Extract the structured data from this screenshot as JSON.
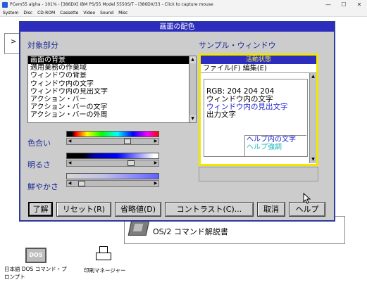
{
  "host": {
    "title": "PCem55 alpha - 101% - [386DX] IBM PS/55 Model 5550S/T - i386DX/33 - Click to capture mouse",
    "menu": [
      "System",
      "Disc",
      "CD-ROM",
      "Cassette",
      "Video",
      "Sound",
      "Misc"
    ],
    "controls": [
      "—",
      "☐",
      "✕"
    ]
  },
  "dialog": {
    "title": "画面の配色",
    "object_label": "対象部分",
    "list_items": [
      "画面の背景",
      "適用業務の作業域",
      "ウィンドウの背景",
      "ウィンドウ内の文字",
      "ウィンドウ内の見出文字",
      "アクション・バー",
      "アクション・バーの文字",
      "アクション・バーの外周"
    ],
    "selected_index": 0,
    "sliders": [
      {
        "label": "色合い",
        "value": 0.7
      },
      {
        "label": "明るさ",
        "value": 0.75
      },
      {
        "label": "鮮やかさ",
        "value": 0.08
      }
    ],
    "sample": {
      "label": "サンプル・ウィンドウ",
      "title": "活動状態",
      "menu": "ファイル(F)  編集(E)",
      "rgb": "RGB: 204 204 204",
      "window_text": "ウィンドウ内の文字",
      "window_heading": "ウィンドウ内の見出文字",
      "output_text": "出力文字",
      "help_text": "ヘルプ内の文字",
      "help_emphasis": "ヘルプ強調"
    },
    "buttons": {
      "ok": "了解",
      "reset": "リセット(R)",
      "default": "省略値(D)",
      "contrast": "コントラスト(C)...",
      "cancel": "取消",
      "help": "ヘルプ"
    }
  },
  "desktop": {
    "bg_window_text": ">",
    "book_label": "OS/2 コマンド解説書",
    "dos_icon_text": "DOS",
    "dos_label": "日本語 DOS コマンド・プロンプト",
    "printer_label": "印刷マネージャー"
  },
  "colors": {
    "dialog_title_bg": "#2c2cbe",
    "label_text": "#1c2a96",
    "sample_border": "#f0e600",
    "heading_text": "#1c1cd0",
    "help_text": "#1c1cd0",
    "help_emphasis": "#20b8b8"
  }
}
